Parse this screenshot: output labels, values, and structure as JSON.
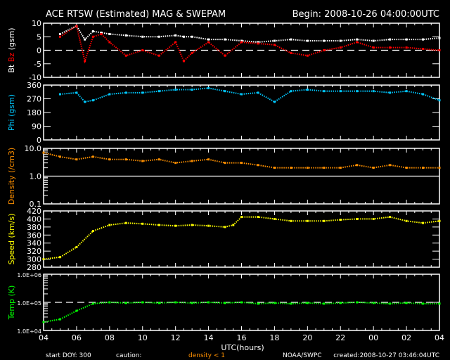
{
  "header": {
    "title": "ACE RTSW (Estimated) MAG & SWEPAM",
    "begin": "Begin: 2008-10-26 04:00:00UTC"
  },
  "footer": {
    "start_doy": "start DOY: 300",
    "caution": "caution:",
    "caution_note": "density < 1",
    "agency": "NOAA/SWPC",
    "created": "created:2008-10-27 03:46:04UTC"
  },
  "colors": {
    "bt": "#ffffff",
    "bz": "#ff0000",
    "phi": "#00c8ff",
    "density": "#ff9000",
    "speed": "#ffff00",
    "temp": "#00ff00"
  },
  "chart_data": [
    {
      "type": "scatter",
      "ylabel_parts": [
        "Bt",
        "Bz",
        "(gsm)"
      ],
      "ylim": [
        -10,
        10
      ],
      "scale": "linear",
      "yticks": [
        "10",
        "5",
        "0",
        "-5",
        "-10"
      ],
      "yticks_values": [
        10,
        5,
        0,
        -5,
        -10
      ],
      "ref_line": 0,
      "x": [
        5,
        6,
        6.5,
        7,
        7.5,
        8,
        9,
        10,
        11,
        12,
        12.5,
        13,
        14,
        15,
        16,
        17,
        18,
        19,
        20,
        21,
        22,
        23,
        24,
        25,
        26,
        27,
        28
      ],
      "series": [
        {
          "name": "Bt",
          "color": "#ffffff",
          "values": [
            6,
            9,
            4,
            7,
            6.5,
            6,
            5.5,
            5,
            5,
            5.5,
            5,
            5,
            4,
            4,
            3.5,
            3,
            3.5,
            4,
            3.5,
            3.5,
            3.5,
            4,
            3.5,
            4,
            4,
            4,
            4.5
          ]
        },
        {
          "name": "Bz",
          "color": "#ff0000",
          "values": [
            5,
            9,
            -4,
            5,
            6,
            3,
            -2,
            0,
            -2,
            3,
            -4,
            -1,
            3,
            -2,
            3,
            2.5,
            2,
            -1,
            -2,
            0,
            1,
            3,
            1,
            1,
            1,
            0.5,
            0
          ]
        }
      ]
    },
    {
      "type": "scatter",
      "ylabel": "Phi (gsm)",
      "ylim": [
        0,
        360
      ],
      "scale": "linear",
      "yticks": [
        "360",
        "270",
        "180",
        "90",
        "0"
      ],
      "yticks_values": [
        360,
        270,
        180,
        90,
        0
      ],
      "x": [
        5,
        6,
        6.5,
        7,
        8,
        9,
        10,
        11,
        12,
        13,
        14,
        15,
        16,
        17,
        18,
        19,
        20,
        21,
        22,
        23,
        24,
        25,
        26,
        27,
        28
      ],
      "series": [
        {
          "name": "Phi",
          "color": "#00c8ff",
          "values": [
            300,
            310,
            250,
            260,
            300,
            310,
            310,
            320,
            330,
            330,
            340,
            320,
            300,
            310,
            250,
            320,
            330,
            320,
            320,
            320,
            320,
            310,
            320,
            300,
            260
          ]
        }
      ]
    },
    {
      "type": "scatter",
      "ylabel": "Density (/cm3)",
      "ylim": [
        0.1,
        10
      ],
      "scale": "log",
      "yticks": [
        "10.0",
        "1.0",
        "0.1"
      ],
      "yticks_values": [
        10,
        1,
        0.1
      ],
      "ref_line": 1,
      "x": [
        4,
        5,
        6,
        7,
        8,
        9,
        10,
        11,
        12,
        13,
        14,
        15,
        16,
        17,
        18,
        19,
        20,
        21,
        22,
        23,
        24,
        25,
        26,
        27,
        28
      ],
      "series": [
        {
          "name": "Density",
          "color": "#ff9000",
          "values": [
            7,
            5,
            4,
            5,
            4,
            4,
            3.5,
            4,
            3,
            3.5,
            4,
            3,
            3,
            2.5,
            2,
            2,
            2,
            2,
            2,
            2.5,
            2,
            2.5,
            2,
            2,
            2
          ]
        }
      ]
    },
    {
      "type": "scatter",
      "ylabel": "Speed (km/s)",
      "ylim": [
        280,
        420
      ],
      "scale": "linear",
      "yticks": [
        "420",
        "400",
        "380",
        "360",
        "340",
        "320",
        "300",
        "280"
      ],
      "yticks_values": [
        420,
        400,
        380,
        360,
        340,
        320,
        300,
        280
      ],
      "x": [
        4,
        5,
        6,
        7,
        8,
        9,
        10,
        11,
        12,
        13,
        14,
        15,
        15.5,
        16,
        17,
        18,
        19,
        20,
        21,
        22,
        23,
        24,
        25,
        26,
        27,
        28
      ],
      "series": [
        {
          "name": "Speed",
          "color": "#ffff00",
          "values": [
            300,
            305,
            330,
            370,
            385,
            390,
            388,
            385,
            383,
            385,
            383,
            380,
            385,
            405,
            405,
            400,
            395,
            395,
            395,
            398,
            400,
            400,
            405,
            395,
            390,
            395
          ]
        }
      ]
    },
    {
      "type": "scatter",
      "ylabel": "Temp (K)",
      "ylim": [
        10000,
        1000000
      ],
      "scale": "log",
      "yticks": [
        "1.0E+06",
        "1.0E+05",
        "1.0E+04"
      ],
      "yticks_values": [
        1000000,
        100000,
        10000
      ],
      "ref_line": 100000,
      "x": [
        4,
        5,
        6,
        7,
        8,
        9,
        10,
        11,
        12,
        13,
        14,
        15,
        16,
        17,
        18,
        19,
        20,
        21,
        22,
        23,
        24,
        25,
        26,
        27,
        28
      ],
      "series": [
        {
          "name": "Temp",
          "color": "#00ff00",
          "values": [
            20000,
            25000,
            50000,
            90000,
            100000,
            95000,
            100000,
            95000,
            100000,
            95000,
            100000,
            95000,
            100000,
            90000,
            95000,
            90000,
            95000,
            90000,
            95000,
            100000,
            95000,
            90000,
            95000,
            90000,
            90000
          ]
        }
      ]
    }
  ],
  "xaxis": {
    "label": "UTC(hours)",
    "xlim": [
      4,
      28
    ],
    "ticks": [
      "04",
      "06",
      "08",
      "10",
      "12",
      "14",
      "16",
      "18",
      "20",
      "22",
      "00",
      "02",
      "04"
    ],
    "tick_values": [
      4,
      6,
      8,
      10,
      12,
      14,
      16,
      18,
      20,
      22,
      24,
      26,
      28
    ]
  }
}
